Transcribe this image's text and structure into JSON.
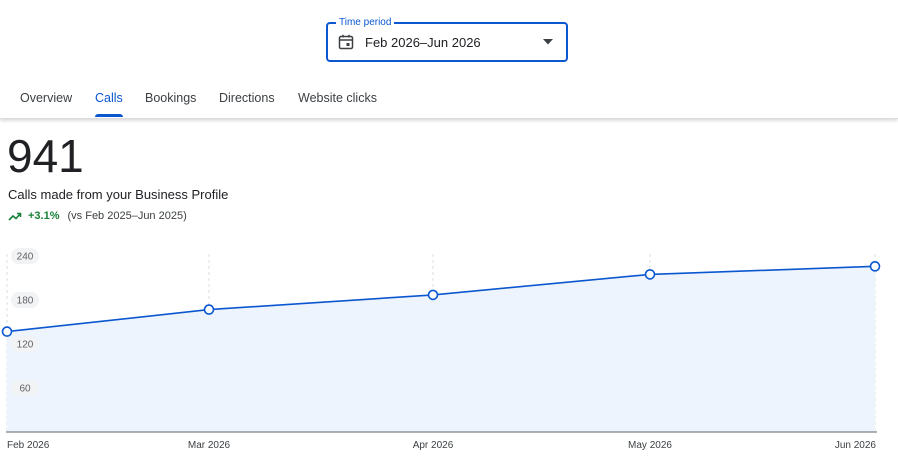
{
  "time_period": {
    "label": "Time period",
    "value": "Feb 2026–Jun 2026"
  },
  "tabs": [
    {
      "label": "Overview",
      "active": false
    },
    {
      "label": "Calls",
      "active": true
    },
    {
      "label": "Bookings",
      "active": false
    },
    {
      "label": "Directions",
      "active": false
    },
    {
      "label": "Website clicks",
      "active": false
    }
  ],
  "metric": {
    "value": "941",
    "description": "Calls made from your Business Profile",
    "change": "+3.1%",
    "comparison": "(vs Feb 2025–Jun 2025)"
  },
  "colors": {
    "accent": "#0b57d0",
    "positive": "#188038",
    "area_fill": "#eef4fd"
  },
  "chart_data": {
    "type": "area",
    "categories": [
      "Feb 2026",
      "Mar 2026",
      "Apr 2026",
      "May 2026",
      "Jun 2026"
    ],
    "values": [
      137,
      167,
      187,
      215,
      226
    ],
    "y_ticks": [
      60,
      120,
      180,
      240
    ],
    "ylim": [
      0,
      270
    ],
    "grid": "vertical dashed"
  }
}
